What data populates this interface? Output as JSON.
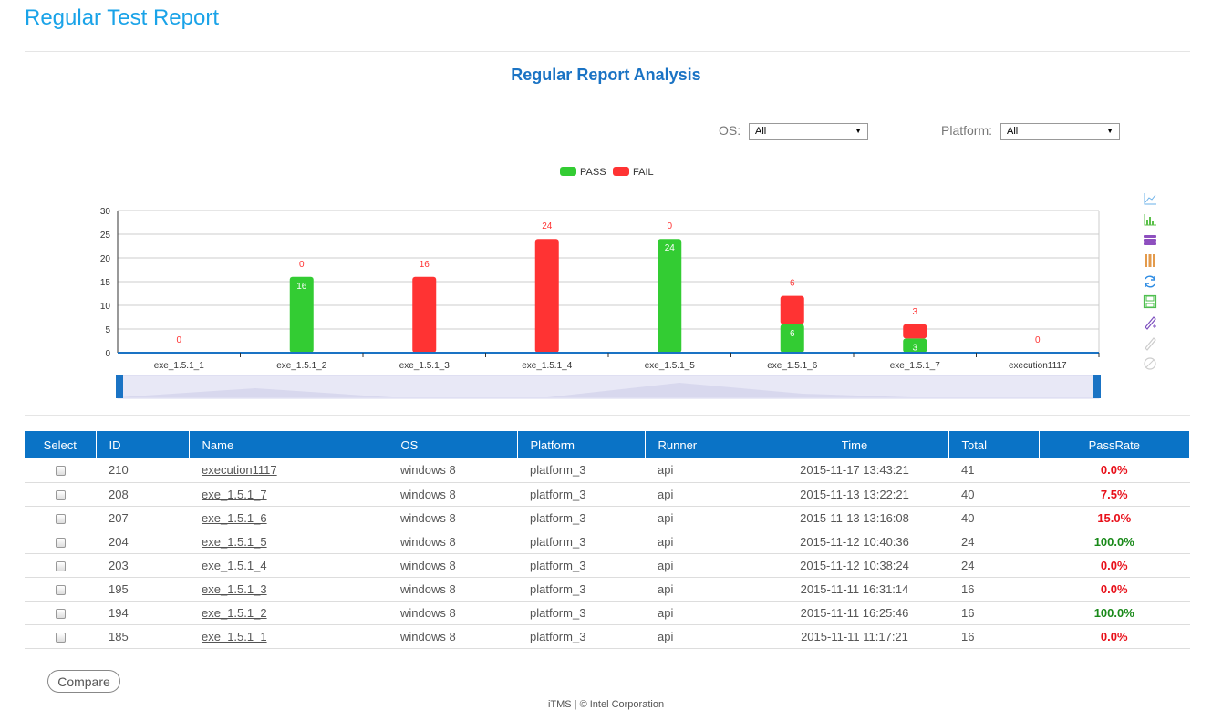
{
  "header": {
    "title": "Regular Test Report"
  },
  "analysis": {
    "title": "Regular Report Analysis"
  },
  "filters": {
    "os_label": "OS:",
    "os_value": "All",
    "platform_label": "Platform:",
    "platform_value": "All"
  },
  "chart_data": {
    "type": "bar",
    "stacked": true,
    "categories": [
      "exe_1.5.1_1",
      "exe_1.5.1_2",
      "exe_1.5.1_3",
      "exe_1.5.1_4",
      "exe_1.5.1_5",
      "exe_1.5.1_6",
      "exe_1.5.1_7",
      "execution1117"
    ],
    "series": [
      {
        "name": "PASS",
        "color": "#33cc33",
        "values": [
          0,
          16,
          0,
          0,
          24,
          6,
          3,
          0
        ]
      },
      {
        "name": "FAIL",
        "color": "#ff3333",
        "values": [
          0,
          0,
          16,
          24,
          0,
          6,
          3,
          0
        ]
      }
    ],
    "ylim": [
      0,
      30
    ],
    "yticks": [
      0,
      5,
      10,
      15,
      20,
      25,
      30
    ],
    "legend": "top-center",
    "grid": true
  },
  "toolbox": [
    "line-chart-icon",
    "bar-chart-icon",
    "stack-icon",
    "tiled-icon",
    "restore-icon",
    "save-image-icon",
    "mark-icon",
    "mark-undo-icon",
    "mark-clear-icon"
  ],
  "table": {
    "headers": [
      "Select",
      "ID",
      "Name",
      "OS",
      "Platform",
      "Runner",
      "Time",
      "Total",
      "PassRate"
    ],
    "rows": [
      {
        "id": "210",
        "name": "execution1117",
        "os": "windows 8",
        "platform": "platform_3",
        "runner": "api",
        "time": "2015-11-17 13:43:21",
        "total": "41",
        "passrate": "0.0%"
      },
      {
        "id": "208",
        "name": "exe_1.5.1_7",
        "os": "windows 8",
        "platform": "platform_3",
        "runner": "api",
        "time": "2015-11-13 13:22:21",
        "total": "40",
        "passrate": "7.5%"
      },
      {
        "id": "207",
        "name": "exe_1.5.1_6",
        "os": "windows 8",
        "platform": "platform_3",
        "runner": "api",
        "time": "2015-11-13 13:16:08",
        "total": "40",
        "passrate": "15.0%"
      },
      {
        "id": "204",
        "name": "exe_1.5.1_5",
        "os": "windows 8",
        "platform": "platform_3",
        "runner": "api",
        "time": "2015-11-12 10:40:36",
        "total": "24",
        "passrate": "100.0%"
      },
      {
        "id": "203",
        "name": "exe_1.5.1_4",
        "os": "windows 8",
        "platform": "platform_3",
        "runner": "api",
        "time": "2015-11-12 10:38:24",
        "total": "24",
        "passrate": "0.0%"
      },
      {
        "id": "195",
        "name": "exe_1.5.1_3",
        "os": "windows 8",
        "platform": "platform_3",
        "runner": "api",
        "time": "2015-11-11 16:31:14",
        "total": "16",
        "passrate": "0.0%"
      },
      {
        "id": "194",
        "name": "exe_1.5.1_2",
        "os": "windows 8",
        "platform": "platform_3",
        "runner": "api",
        "time": "2015-11-11 16:25:46",
        "total": "16",
        "passrate": "100.0%"
      },
      {
        "id": "185",
        "name": "exe_1.5.1_1",
        "os": "windows 8",
        "platform": "platform_3",
        "runner": "api",
        "time": "2015-11-11 11:17:21",
        "total": "16",
        "passrate": "0.0%"
      }
    ]
  },
  "colors": {
    "pass_rate_good": "#1a8a1a",
    "pass_rate_bad": "#e8101a"
  },
  "compare_label": "Compare",
  "footer": {
    "text": "iTMS | © Intel Corporation"
  }
}
